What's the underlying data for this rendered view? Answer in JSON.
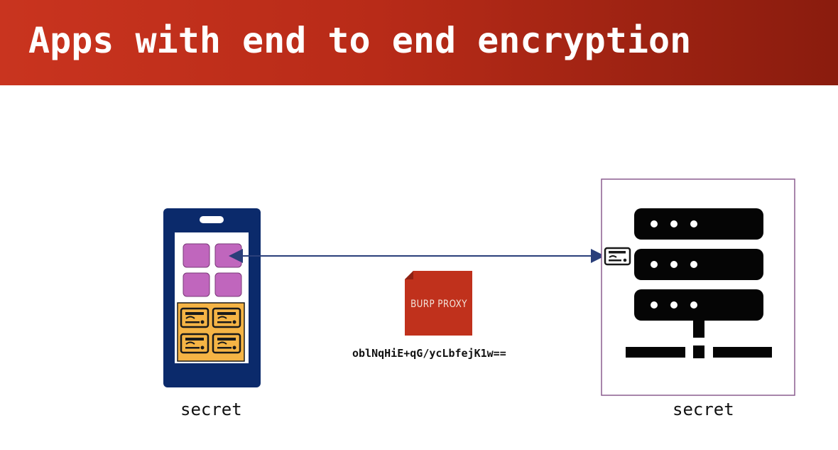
{
  "slide": {
    "title": "Apps with end to end encryption",
    "header_color_left": "#c9341f",
    "header_color_right": "#8a1c0e"
  },
  "diagram": {
    "client": {
      "label": "secret",
      "icon": "smartphone-icon",
      "frame_color": "#0b2a6b",
      "app_tile_color": "#c066bd",
      "card_panel_color": "#f5b445"
    },
    "server": {
      "label": "secret",
      "icon": "server-rack-icon",
      "border_color": "#8b5d8f"
    },
    "proxy": {
      "label": "BURP PROXY",
      "color": "#c0311c"
    },
    "ciphertext": "oblNqHiE+qG/ycLbfejK1w==",
    "connection": {
      "direction": "bidirectional",
      "color": "#2a3f7a"
    }
  }
}
